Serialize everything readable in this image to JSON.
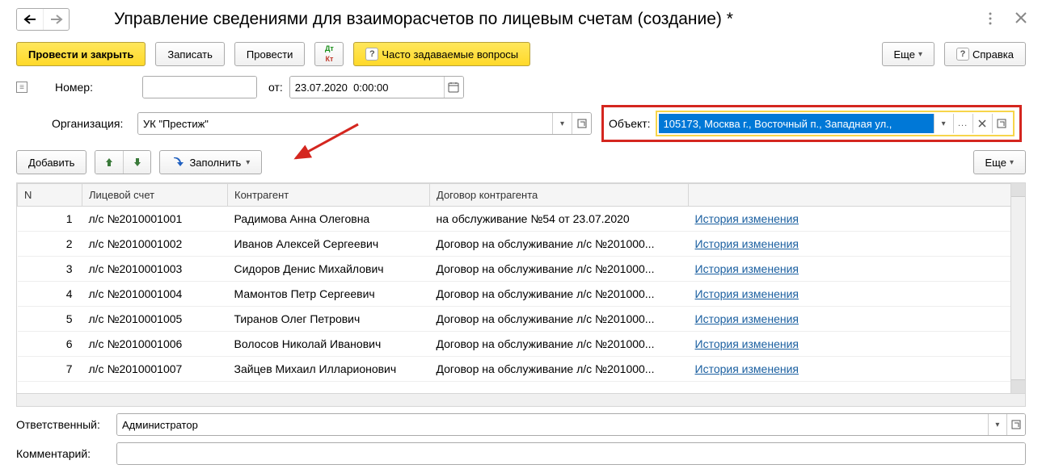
{
  "header": {
    "title": "Управление сведениями для взаиморасчетов по лицевым счетам (создание) *"
  },
  "toolbar": {
    "post_close": "Провести и закрыть",
    "write": "Записать",
    "post": "Провести",
    "dt": "Дт",
    "kt": "Кт",
    "faq": "Часто задаваемые вопросы",
    "more": "Еще",
    "help": "Справка"
  },
  "fields": {
    "number_label": "Номер:",
    "number_value": "",
    "from_label": "от:",
    "date_value": "23.07.2020  0:00:00",
    "org_label": "Организация:",
    "org_value": "УК \"Престиж\"",
    "object_label": "Объект:",
    "object_value": "105173, Москва г., Восточный п., Западная ул.,"
  },
  "table_toolbar": {
    "add": "Добавить",
    "fill": "Заполнить",
    "more": "Еще"
  },
  "table": {
    "headers": {
      "n": "N",
      "ls": "Лицевой счет",
      "ka": "Контрагент",
      "dk": "Договор контрагента",
      "hist": ""
    },
    "rows": [
      {
        "n": "1",
        "ls": "л/с №2010001001",
        "ka": "Радимова Анна Олеговна",
        "dk": "на обслуживание №54 от 23.07.2020",
        "hist": "История изменения"
      },
      {
        "n": "2",
        "ls": "л/с №2010001002",
        "ka": "Иванов Алексей Сергеевич",
        "dk": "Договор на обслуживание л/с №201000...",
        "hist": "История изменения"
      },
      {
        "n": "3",
        "ls": "л/с №2010001003",
        "ka": "Сидоров Денис Михайлович",
        "dk": "Договор на обслуживание л/с №201000...",
        "hist": "История изменения"
      },
      {
        "n": "4",
        "ls": "л/с №2010001004",
        "ka": "Мамонтов Петр Сергеевич",
        "dk": "Договор на обслуживание л/с №201000...",
        "hist": "История изменения"
      },
      {
        "n": "5",
        "ls": "л/с №2010001005",
        "ka": "Тиранов Олег Петрович",
        "dk": "Договор на обслуживание л/с №201000...",
        "hist": "История изменения"
      },
      {
        "n": "6",
        "ls": "л/с №2010001006",
        "ka": "Волосов Николай Иванович",
        "dk": "Договор на обслуживание л/с №201000...",
        "hist": "История изменения"
      },
      {
        "n": "7",
        "ls": "л/с №2010001007",
        "ka": "Зайцев Михаил Илларионович",
        "dk": "Договор на обслуживание л/с №201000...",
        "hist": "История изменения"
      }
    ]
  },
  "footer": {
    "resp_label": "Ответственный:",
    "resp_value": "Администратор",
    "comment_label": "Комментарий:",
    "comment_value": ""
  }
}
